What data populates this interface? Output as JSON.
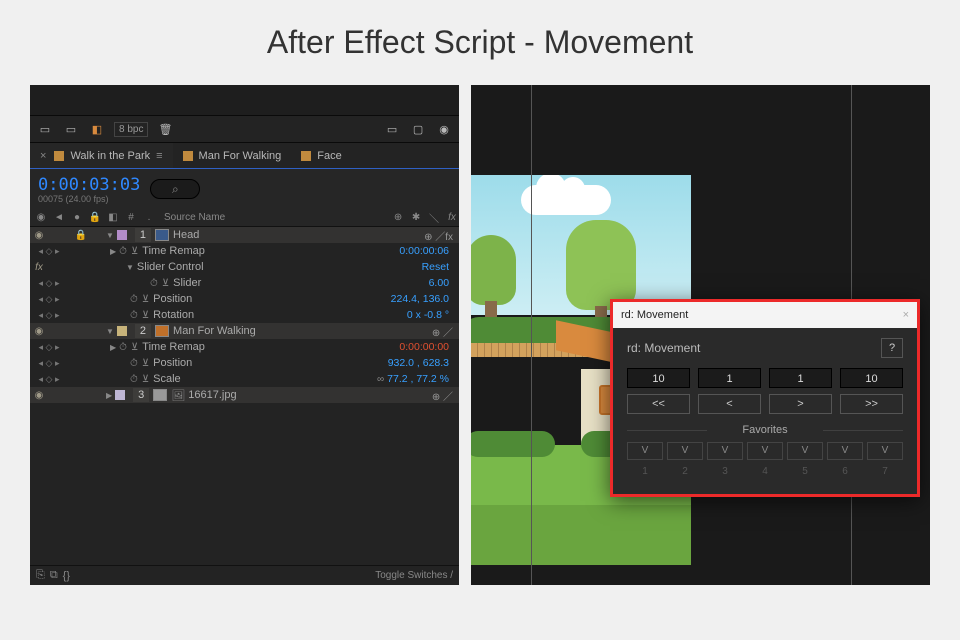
{
  "page_title": "After Effect Script - Movement",
  "left": {
    "toolbar_bpc": "8 bpc",
    "tabs": [
      {
        "label": "Walk in the Park",
        "active": true
      },
      {
        "label": "Man For Walking",
        "active": false
      },
      {
        "label": "Face",
        "active": false
      }
    ],
    "timecode": "0:00:03:03",
    "time_sub": "00075 (24.00 fps)",
    "search_placeholder": "⌕",
    "col_source": "Source Name",
    "rows": {
      "layer1": {
        "num": "1",
        "name": "Head",
        "switches": "⊕ ／fx"
      },
      "time_remap_1": {
        "label": "Time Remap",
        "value": "0:00:00:06"
      },
      "slider_control": {
        "label": "Slider Control",
        "value": "Reset"
      },
      "slider": {
        "label": "Slider",
        "value": "6.00"
      },
      "position_1": {
        "label": "Position",
        "value": "224.4, 136.0"
      },
      "rotation": {
        "label": "Rotation",
        "value": "0 x -0.8 °"
      },
      "layer2": {
        "num": "2",
        "name": "Man For Walking",
        "switches": "⊕ ／"
      },
      "time_remap_2": {
        "label": "Time Remap",
        "value": "0:00:00:00"
      },
      "position_2": {
        "label": "Position",
        "value": "932.0 , 628.3"
      },
      "scale": {
        "label": "Scale",
        "value": "77.2 , 77.2 %"
      },
      "layer3": {
        "num": "3",
        "name": "16617.jpg",
        "switches": "⊕ ／"
      }
    },
    "footer_right": "Toggle Switches / "
  },
  "right": {
    "panel": {
      "title": "rd: Movement",
      "header": "rd: Movement",
      "help": "?",
      "inputs": [
        "10",
        "1",
        "1",
        "10"
      ],
      "buttons": [
        "<<",
        "<",
        ">",
        ">>"
      ],
      "favorites_label": "Favorites",
      "fav_v": [
        "V",
        "V",
        "V",
        "V",
        "V",
        "V",
        "V"
      ],
      "fav_n": [
        "1",
        "2",
        "3",
        "4",
        "5",
        "6",
        "7"
      ]
    }
  }
}
